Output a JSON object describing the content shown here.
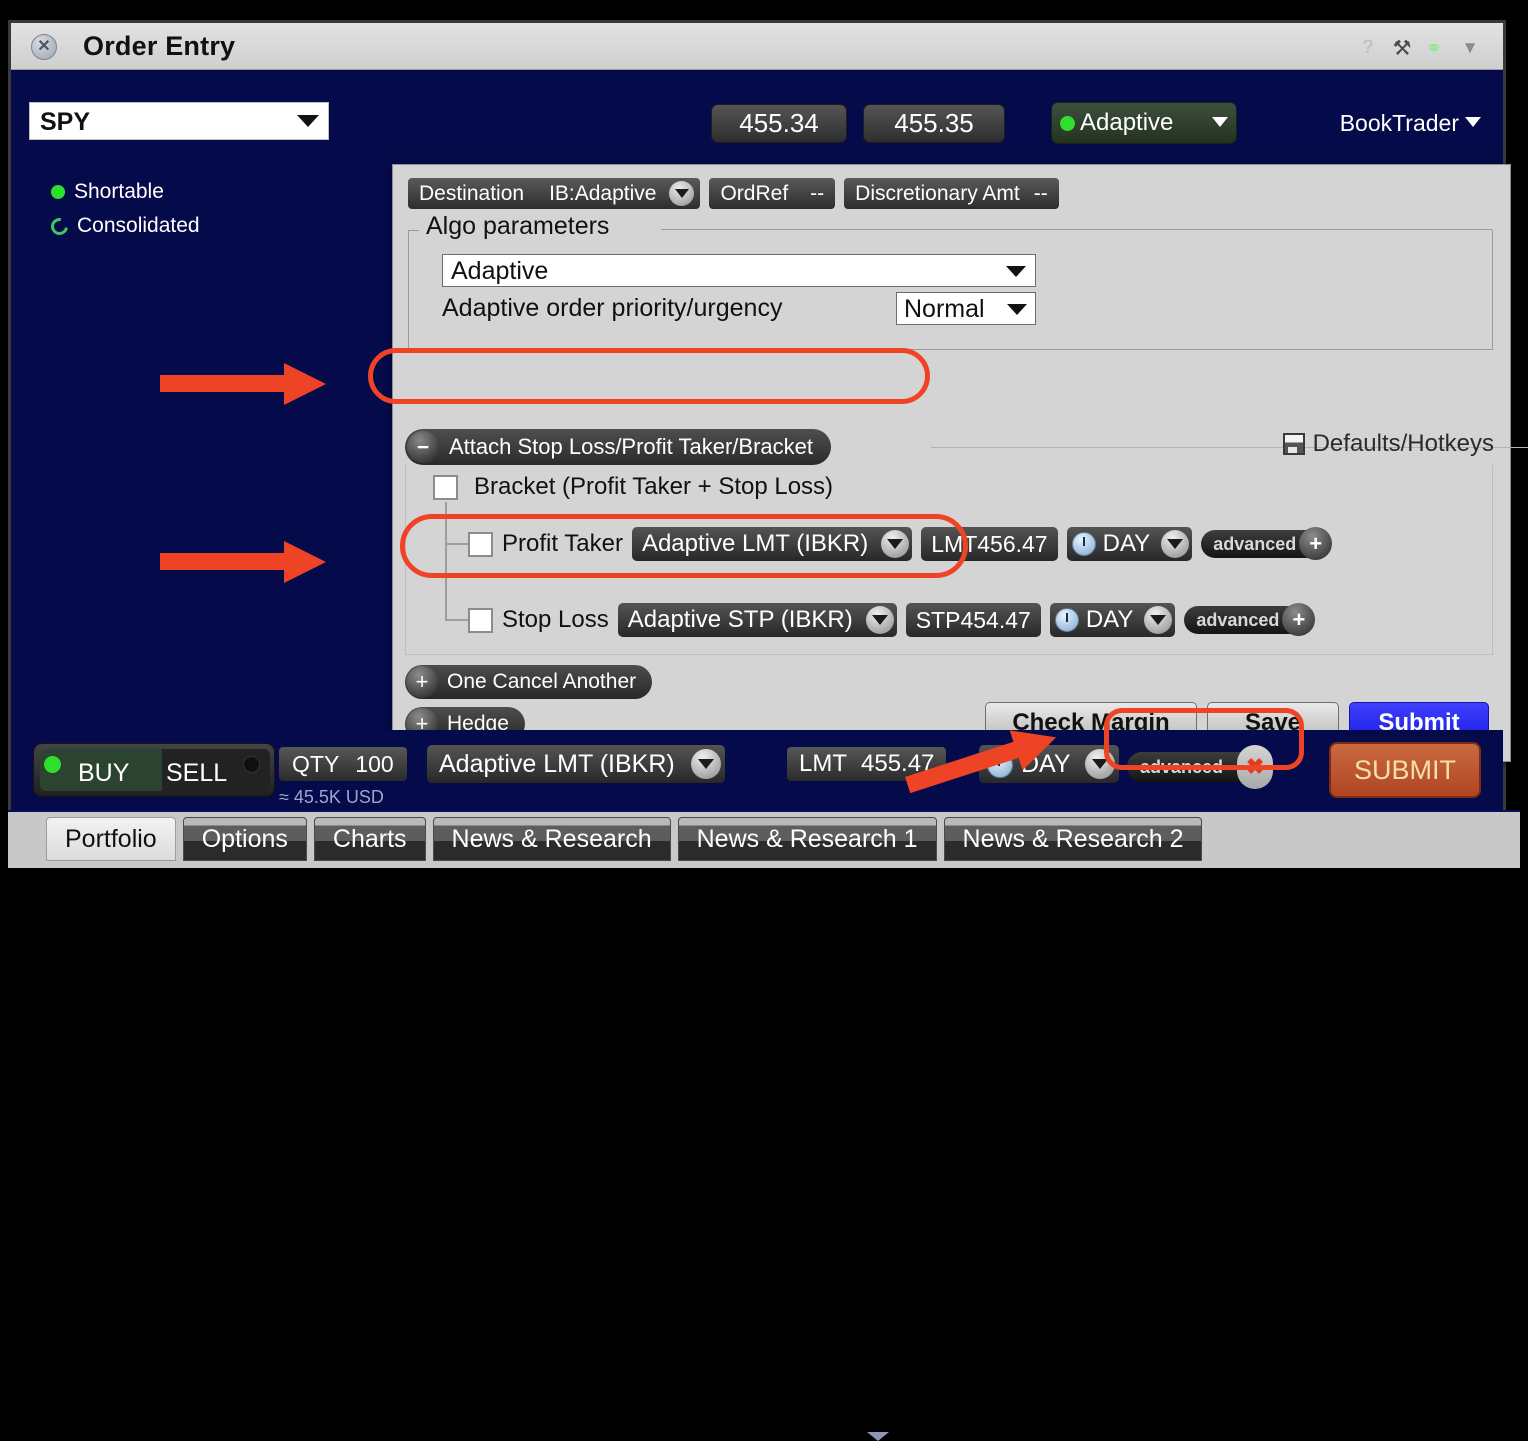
{
  "window": {
    "title": "Order Entry",
    "close_icon": "close-icon",
    "help_icon": "?",
    "wrench_icon": "⚒",
    "link_icon": "⚭",
    "menu_icon": "▼"
  },
  "instrument": {
    "symbol": "SPY",
    "shortable_label": "Shortable",
    "consolidated_label": "Consolidated",
    "bid": "455.34",
    "ask": "455.35",
    "adaptive_badge": "Adaptive",
    "booktrader_label": "BookTrader"
  },
  "panel": {
    "destination_label": "Destination",
    "destination_value": "IB:Adaptive",
    "ordref_label": "OrdRef",
    "ordref_value": "--",
    "discretionary_label": "Discretionary Amt",
    "discretionary_value": "--",
    "algo": {
      "legend": "Algo parameters",
      "strategy": "Adaptive",
      "urgency_label": "Adaptive order priority/urgency",
      "urgency_value": "Normal"
    },
    "attach_label": "Attach Stop Loss/Profit Taker/Bracket",
    "attach_toggle": "−",
    "defaults_label": "Defaults/Hotkeys",
    "bracket_label": "Bracket (Profit Taker + Stop Loss)",
    "profit_taker": {
      "label": "Profit Taker",
      "type": "Adaptive LMT (IBKR)",
      "price": "LMT456.47",
      "tif": "DAY",
      "advanced": "advanced",
      "advanced_toggle": "+"
    },
    "stop_loss": {
      "label": "Stop Loss",
      "type": "Adaptive STP (IBKR)",
      "price": "STP454.47",
      "tif": "DAY",
      "advanced": "advanced",
      "advanced_toggle": "+"
    },
    "oca_label": "One Cancel Another",
    "oca_toggle": "+",
    "hedge_label": "Hedge",
    "hedge_toggle": "+",
    "check_margin_label": "Check Margin",
    "save_label": "Save",
    "submit_label": "Submit"
  },
  "order_bar": {
    "buy_label": "BUY",
    "sell_label": "SELL",
    "qty_label": "QTY",
    "qty_value": "100",
    "approx_value": "≈ 45.5K USD",
    "order_type": "Adaptive LMT (IBKR)",
    "price_label": "LMT",
    "price_value": "455.47",
    "tif": "DAY",
    "advanced_label": "advanced",
    "advanced_close": "✖",
    "submit_label": "SUBMIT"
  },
  "tabs": [
    {
      "label": "Portfolio",
      "active": true
    },
    {
      "label": "Options",
      "active": false
    },
    {
      "label": "Charts",
      "active": false
    },
    {
      "label": "News & Research",
      "active": false
    },
    {
      "label": "News & Research 1",
      "active": false
    },
    {
      "label": "News & Research 2",
      "active": false
    }
  ],
  "colors": {
    "navy": "#050a4a",
    "panel_gray": "#d4d4d4",
    "annotation_red": "#ef4326",
    "submit_blue": "#2a2aee",
    "submit_orange": "#b14423",
    "led_green": "#2de02d"
  }
}
